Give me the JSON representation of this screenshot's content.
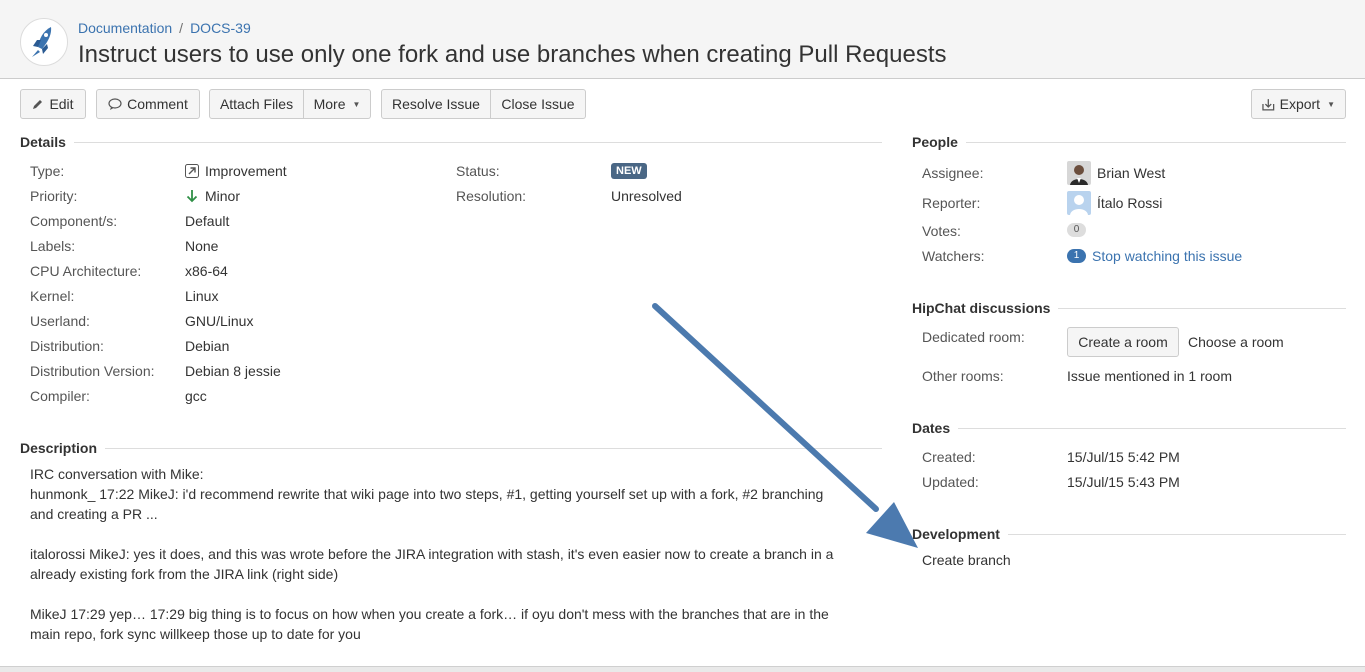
{
  "header": {
    "breadcrumb_project": "Documentation",
    "breadcrumb_separator": "/",
    "breadcrumb_issue_key": "DOCS-39",
    "title": "Instruct users to use only one fork and use branches when creating Pull Requests",
    "project_icon": "rocket-icon"
  },
  "toolbar": {
    "edit": "Edit",
    "comment": "Comment",
    "attach_files": "Attach Files",
    "more": "More",
    "resolve_issue": "Resolve Issue",
    "close_issue": "Close Issue",
    "export": "Export"
  },
  "details": {
    "heading": "Details",
    "type_label": "Type:",
    "type_value": "Improvement",
    "priority_label": "Priority:",
    "priority_value": "Minor",
    "components_label": "Component/s:",
    "components_value": "Default",
    "labels_label": "Labels:",
    "labels_value": "None",
    "cpu_label": "CPU Architecture:",
    "cpu_value": "x86-64",
    "kernel_label": "Kernel:",
    "kernel_value": "Linux",
    "userland_label": "Userland:",
    "userland_value": "GNU/Linux",
    "distribution_label": "Distribution:",
    "distribution_value": "Debian",
    "dist_version_label": "Distribution Version:",
    "dist_version_value": "Debian 8 jessie",
    "compiler_label": "Compiler:",
    "compiler_value": "gcc",
    "status_label": "Status:",
    "status_value": "NEW",
    "resolution_label": "Resolution:",
    "resolution_value": "Unresolved"
  },
  "description": {
    "heading": "Description",
    "line1": "IRC conversation with Mike:",
    "line2": "hunmonk_ 17:22 MikeJ: i'd recommend rewrite that wiki page into two steps, #1, getting yourself set up with a fork, #2 branching and creating a PR ...",
    "para2": "italorossi MikeJ: yes it does, and this was wrote before the JIRA integration with stash, it's even easier now to create a branch in a already existing fork from the JIRA link (right side)",
    "para3": "MikeJ 17:29 yep… 17:29 big thing is to focus on how when you create a fork… if oyu don't mess with the branches that are in the main repo, fork sync willkeep those up to date for you"
  },
  "people": {
    "heading": "People",
    "assignee_label": "Assignee:",
    "assignee_value": "Brian West",
    "reporter_label": "Reporter:",
    "reporter_value": "Ítalo Rossi",
    "votes_label": "Votes:",
    "votes_value": "0",
    "watchers_label": "Watchers:",
    "watchers_count": "1",
    "watchers_link": "Stop watching this issue"
  },
  "hipchat": {
    "heading": "HipChat discussions",
    "dedicated_label": "Dedicated room:",
    "create_room": "Create a room",
    "choose_room": "Choose a room",
    "other_label": "Other rooms:",
    "other_value": "Issue mentioned in 1 room"
  },
  "dates": {
    "heading": "Dates",
    "created_label": "Created:",
    "created_value": "15/Jul/15 5:42 PM",
    "updated_label": "Updated:",
    "updated_value": "15/Jul/15 5:43 PM"
  },
  "development": {
    "heading": "Development",
    "create_branch": "Create branch"
  },
  "colors": {
    "link": "#3b73af",
    "lozenge": "#4a6785",
    "arrow": "#3d6fa8",
    "header_bg": "#f5f5f5"
  }
}
